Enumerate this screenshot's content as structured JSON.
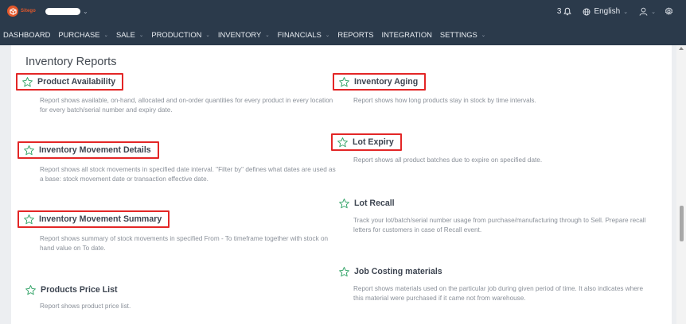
{
  "app": {
    "logo_text": "Sitego"
  },
  "header": {
    "notification_count": "3",
    "language": "English"
  },
  "nav": [
    {
      "label": "DASHBOARD",
      "dropdown": false
    },
    {
      "label": "PURCHASE",
      "dropdown": true
    },
    {
      "label": "SALE",
      "dropdown": true
    },
    {
      "label": "PRODUCTION",
      "dropdown": true
    },
    {
      "label": "INVENTORY",
      "dropdown": true
    },
    {
      "label": "FINANCIALS",
      "dropdown": true
    },
    {
      "label": "REPORTS",
      "dropdown": false
    },
    {
      "label": "INTEGRATION",
      "dropdown": false
    },
    {
      "label": "SETTINGS",
      "dropdown": true
    }
  ],
  "page": {
    "title": "Inventory Reports"
  },
  "reports": [
    {
      "title": "Product Availability",
      "description": "Report shows available, on-hand, allocated and on-order quantities for every product in every location for every batch/serial number and expiry date.",
      "highlighted": true
    },
    {
      "title": "Inventory Aging",
      "description": "Report shows how long products stay in stock by time intervals.",
      "highlighted": true
    },
    {
      "title": "Inventory Movement Details",
      "description": "Report shows all stock movements in specified date interval. \"Filter by\" defines what dates are used as a base: stock movement date or transaction effective date.",
      "highlighted": true
    },
    {
      "title": "Lot Expiry",
      "description": "Report shows all product batches due to expire on specified date.",
      "highlighted": true
    },
    {
      "title": "Lot Recall",
      "description": "Track your lot/batch/serial number usage from purchase/manufacturing through to Sell. Prepare recall letters for customers in case of Recall event.",
      "highlighted": false
    },
    {
      "title": "Inventory Movement Summary",
      "description": "Report shows summary of stock movements in specified From - To timeframe together with stock on hand value on To date.",
      "highlighted": true
    },
    {
      "title": "Job Costing materials",
      "description": "Report shows materials used on the particular job during given period of time. It also indicates where this material were purchased if it came not from warehouse.",
      "highlighted": false
    },
    {
      "title": "Products Price List",
      "description": "Report shows product price list.",
      "highlighted": false
    }
  ],
  "colors": {
    "header_bg": "#2b3a4b",
    "brand": "#e4582b",
    "star": "#3aa76d",
    "highlight_border": "#e32626"
  },
  "icons": {
    "notification": "bell-icon",
    "language": "globe-icon",
    "user": "user-icon",
    "settings": "gear-icon",
    "favorite": "star-outline-icon"
  }
}
